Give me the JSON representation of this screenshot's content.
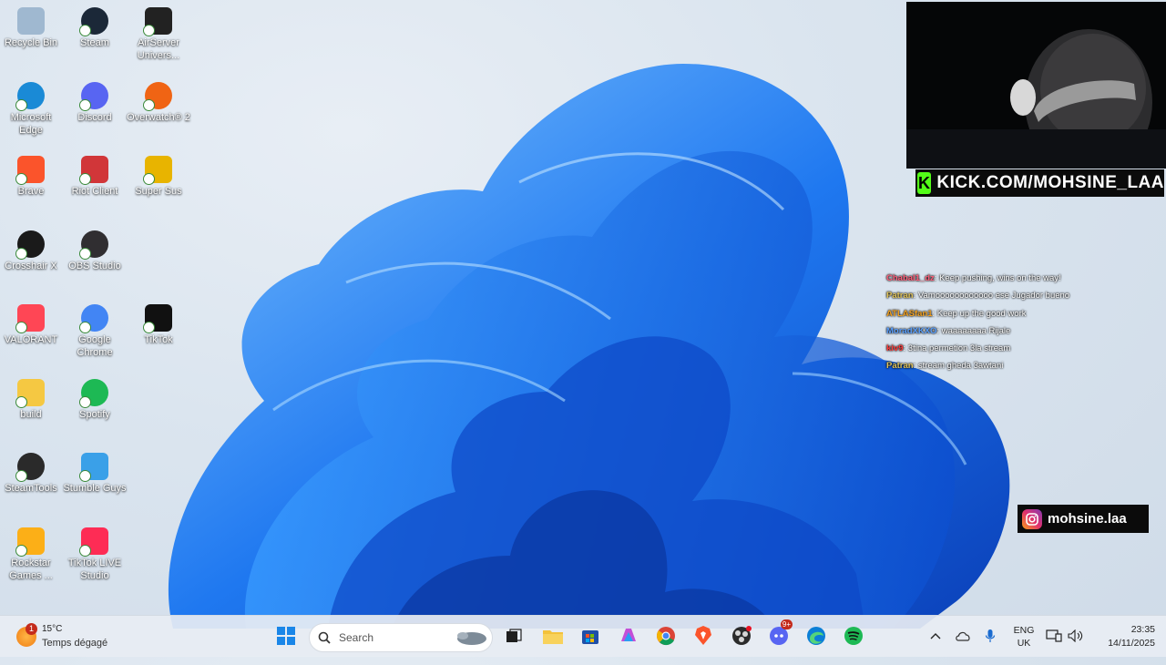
{
  "desktop": {
    "icons": [
      {
        "label": "Recycle Bin",
        "icon": "recycle-bin-icon",
        "color": "#9fb8d0"
      },
      {
        "label": "Steam",
        "icon": "steam-icon",
        "color": "#1b2838"
      },
      {
        "label": "AirServer Univers...",
        "icon": "airserver-icon",
        "color": "#222222"
      },
      {
        "label": "Microsoft Edge",
        "icon": "edge-icon",
        "color": "#1a8ad6"
      },
      {
        "label": "Discord",
        "icon": "discord-icon",
        "color": "#5865f2"
      },
      {
        "label": "Overwatch® 2",
        "icon": "overwatch-icon",
        "color": "#f06414"
      },
      {
        "label": "Brave",
        "icon": "brave-icon",
        "color": "#fb542b"
      },
      {
        "label": "Riot Client",
        "icon": "riot-icon",
        "color": "#d13639"
      },
      {
        "label": "Super Sus",
        "icon": "super-sus-icon",
        "color": "#e8b400"
      },
      {
        "label": "Crosshair X",
        "icon": "crosshair-icon",
        "color": "#1a1a1a"
      },
      {
        "label": "OBS Studio",
        "icon": "obs-icon",
        "color": "#302e31"
      },
      {
        "label": "VALORANT",
        "icon": "valorant-icon",
        "color": "#ff4655"
      },
      {
        "label": "Google Chrome",
        "icon": "chrome-icon",
        "color": "#4285f4"
      },
      {
        "label": "TikTok",
        "icon": "tiktok-icon",
        "color": "#111111"
      },
      {
        "label": "build",
        "icon": "folder-icon",
        "color": "#f5c842"
      },
      {
        "label": "Spotify",
        "icon": "spotify-icon",
        "color": "#1db954"
      },
      {
        "label": "SteamTools",
        "icon": "steamtools-icon",
        "color": "#2a2a2a"
      },
      {
        "label": "Stumble Guys",
        "icon": "stumble-guys-icon",
        "color": "#3aa0e8"
      },
      {
        "label": "Rockstar Games ...",
        "icon": "rockstar-icon",
        "color": "#fcaf17"
      },
      {
        "label": "TikTok LIVE Studio",
        "icon": "tiktok-live-icon",
        "color": "#fe2c55"
      }
    ]
  },
  "overlay": {
    "kick_text": "KICK.COM/MOHSINE_LAA",
    "instagram_text": "mohsine.laa",
    "chat": [
      {
        "user": "Chabal1_dz",
        "color": "#ff5f7a",
        "message": "Keep pushing, wins on the way!"
      },
      {
        "user": "Patran",
        "color": "#e0c35a",
        "message": "Vamoooooooooooo ese Jugador bueno"
      },
      {
        "user": "ATLASfan1",
        "color": "#f0a020",
        "message": "Keep up the good work"
      },
      {
        "user": "MoradXKXO",
        "color": "#5aa0ff",
        "message": "waaaaaaaa Rijale"
      },
      {
        "user": "kiv9",
        "color": "#ff3b3b",
        "message": "3tina permetion 3la stream"
      },
      {
        "user": "Patran",
        "color": "#e0c35a",
        "message": "stream gheda 3awtani"
      }
    ]
  },
  "taskbar": {
    "weather_temp": "15°C",
    "weather_cond": "Temps dégagé",
    "weather_badge": "1",
    "search_placeholder": "Search",
    "discord_badge": "9+",
    "lang_top": "ENG",
    "lang_bottom": "UK",
    "time": "23:35",
    "date": "14/11/2025"
  }
}
